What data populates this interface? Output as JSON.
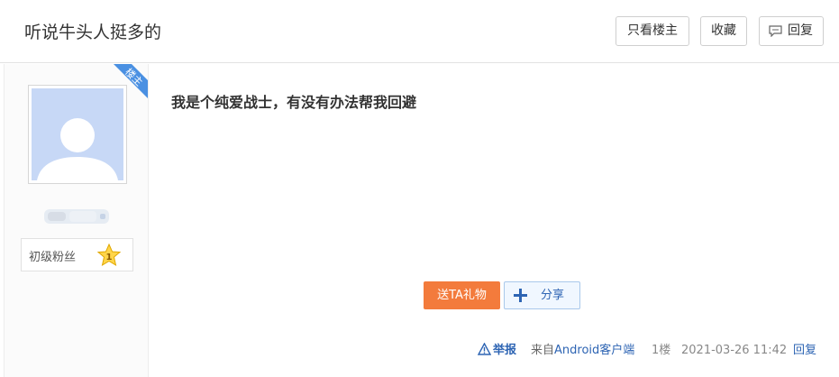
{
  "header": {
    "thread_title": "听说牛头人挺多的",
    "only_op_label": "只看楼主",
    "favorite_label": "收藏",
    "reply_label": "回复"
  },
  "author": {
    "badge": "楼主",
    "level_title": "初级粉丝",
    "level_number": "1"
  },
  "post": {
    "content": "我是个纯爱战士，有没有办法帮我回避",
    "gift_label": "送TA礼物",
    "share_label": "分享"
  },
  "footer": {
    "report_label": "举报",
    "source_prefix": "来自",
    "source_client": "Android客户端",
    "floor": "1楼",
    "time": "2021-03-26 11:42",
    "reply_label": "回复"
  },
  "colors": {
    "accent_blue": "#2d64b3",
    "gift_orange": "#f37b3c",
    "badge_blue": "#4a90e2",
    "avatar_bg": "#c7d8f6"
  }
}
